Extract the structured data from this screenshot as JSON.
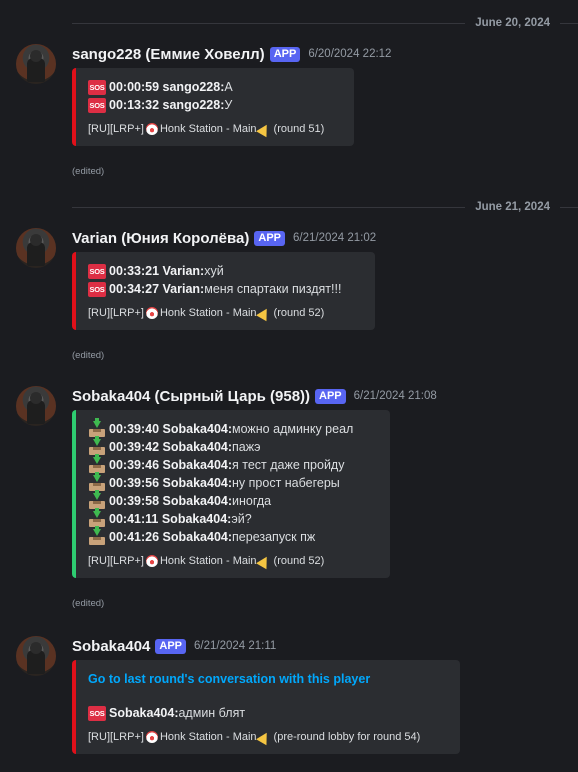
{
  "dates": [
    "June 20, 2024",
    "June 21, 2024"
  ],
  "app_badge": "APP",
  "edited_label": "(edited)",
  "messages": [
    {
      "username": "sango228 (Еммие Ховелл)",
      "timestamp": "6/20/2024 22:12",
      "icon": "sos-icon",
      "lines": [
        {
          "time": "00:00:59",
          "sender": "sango228:",
          "text": " А"
        },
        {
          "time": "00:13:32",
          "sender": "sango228:",
          "text": " У"
        }
      ],
      "footer": {
        "server": "[RU][LRP+]",
        "station": "Honk Station - Main",
        "round": "(round 51)"
      }
    },
    {
      "username": "Varian (Юния Королёва)",
      "timestamp": "6/21/2024 21:02",
      "icon": "sos-icon",
      "lines": [
        {
          "time": "00:33:21",
          "sender": "Varian:",
          "text": " хуй"
        },
        {
          "time": "00:34:27",
          "sender": "Varian:",
          "text": " меня спартаки пиздят!!!"
        }
      ],
      "footer": {
        "server": "[RU][LRP+]",
        "station": "Honk Station - Main",
        "round": "(round 52)"
      }
    },
    {
      "username": "Sobaka404 (Сырный Царь (958))",
      "timestamp": "6/21/2024 21:08",
      "icon": "inbox-tray-icon",
      "lines": [
        {
          "time": "00:39:40",
          "sender": "Sobaka404:",
          "text": " можно админку реал"
        },
        {
          "time": "00:39:42",
          "sender": "Sobaka404:",
          "text": " пажэ"
        },
        {
          "time": "00:39:46",
          "sender": "Sobaka404:",
          "text": " я тест даже пройду"
        },
        {
          "time": "00:39:56",
          "sender": "Sobaka404:",
          "text": " ну прост набегеры"
        },
        {
          "time": "00:39:58",
          "sender": "Sobaka404:",
          "text": " иногда"
        },
        {
          "time": "00:41:11",
          "sender": "Sobaka404:",
          "text": " эй?"
        },
        {
          "time": "00:41:26",
          "sender": "Sobaka404:",
          "text": " перезапуск пж"
        }
      ],
      "footer": {
        "server": "[RU][LRP+]",
        "station": "Honk Station - Main",
        "round": "(round 52)"
      }
    },
    {
      "username": "Sobaka404",
      "timestamp": "6/21/2024 21:11",
      "icon": "sos-icon",
      "link": "Go to last round's conversation with this player",
      "lines": [
        {
          "time": "",
          "sender": "Sobaka404:",
          "text": " админ блят"
        }
      ],
      "footer": {
        "server": "[RU][LRP+]",
        "station": "Honk Station - Main",
        "round": "(pre-round lobby for round 54)"
      }
    }
  ],
  "sos_text": "SOS",
  "colors": {
    "sos_border": "#e0101a",
    "inbox_border": "#2ecc71",
    "app_badge": "#5865f2",
    "link": "#00a8fc"
  }
}
